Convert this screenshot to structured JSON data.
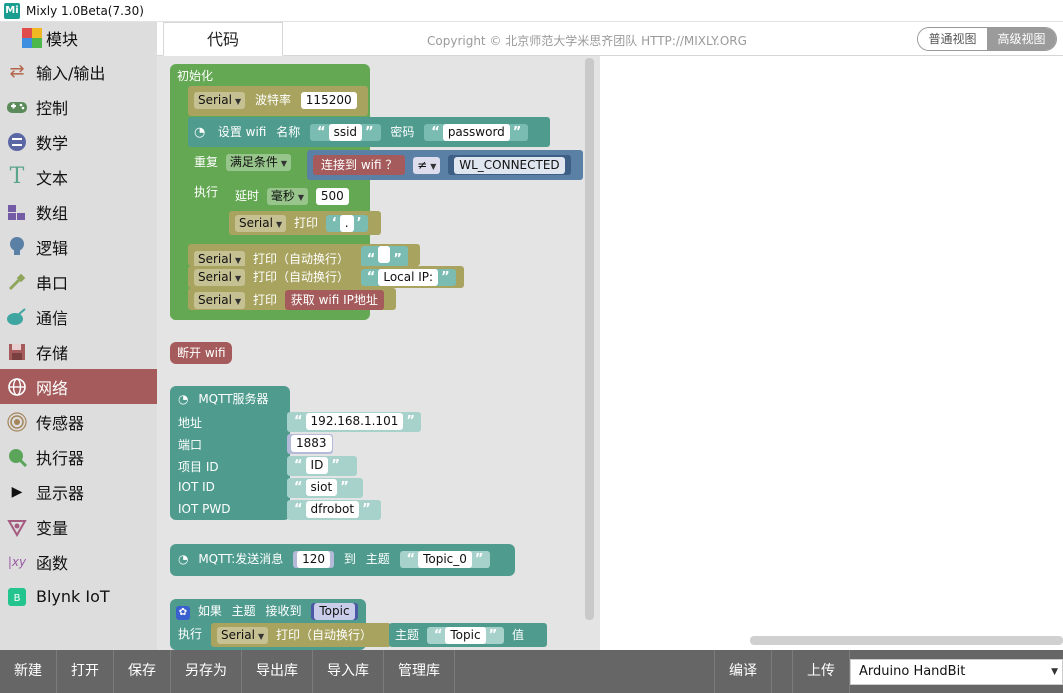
{
  "window": {
    "title": "Mixly 1.0Beta(7.30)",
    "app_icon": "Mi"
  },
  "sidebar": {
    "header": "模块",
    "items": [
      {
        "label": "输入/输出",
        "icon": "io-arrows-icon",
        "color": "#b5654a"
      },
      {
        "label": "控制",
        "icon": "gamepad-icon",
        "color": "#5b8a5b"
      },
      {
        "label": "数学",
        "icon": "math-icon",
        "color": "#5b67a5"
      },
      {
        "label": "文本",
        "icon": "text-t-icon",
        "color": "#5ba58c"
      },
      {
        "label": "数组",
        "icon": "array-blocks-icon",
        "color": "#745ba5"
      },
      {
        "label": "逻辑",
        "icon": "bulb-icon",
        "color": "#5b80a5"
      },
      {
        "label": "串口",
        "icon": "plug-icon",
        "color": "#8fa55b"
      },
      {
        "label": "通信",
        "icon": "satellite-icon",
        "color": "#3fa5a0"
      },
      {
        "label": "存储",
        "icon": "floppy-icon",
        "color": "#a55b5b"
      },
      {
        "label": "网络",
        "icon": "globe-icon",
        "color": "#ffffff",
        "active": true
      },
      {
        "label": "传感器",
        "icon": "sensor-icon",
        "color": "#a5855b"
      },
      {
        "label": "执行器",
        "icon": "actuator-icon",
        "color": "#5ba55b"
      },
      {
        "label": "显示器",
        "icon": "play-triangle-icon",
        "color": "#111111"
      },
      {
        "label": "变量",
        "icon": "variable-icon",
        "color": "#a55b80"
      },
      {
        "label": "函数",
        "icon": "function-icon",
        "color": "#9a5ba5"
      },
      {
        "label": "Blynk IoT",
        "icon": "blynk-icon",
        "color": "#23c48e"
      }
    ]
  },
  "tabbar": {
    "code_tab": "代码",
    "copyright": "Copyright © 北京师范大学米思齐团队 HTTP://MIXLY.ORG",
    "view_normal": "普通视图",
    "view_advanced": "高级视图"
  },
  "blocks": {
    "setup": {
      "label": "初始化",
      "serial": "Serial",
      "baud_label": "波特率",
      "baud": "115200",
      "wifi_label": "设置 wifi",
      "name_label": "名称",
      "ssid": "ssid",
      "pwd_label": "密码",
      "password": "password",
      "repeat_label": "重复",
      "repeat_mode": "满足条件",
      "connected_label": "连接到 wifi ？",
      "neq": "≠",
      "wl_connected": "WL_CONNECTED",
      "do_label": "执行",
      "delay_label": "延时",
      "delay_unit": "毫秒",
      "delay_ms": "500",
      "print_label": "打印",
      "dot": ".",
      "println_label": "打印（自动换行）",
      "local_ip": "Local IP:",
      "get_ip_label": "获取 wifi IP地址"
    },
    "disconnect": {
      "label": "断开 wifi"
    },
    "mqtt_server": {
      "title": "MQTT服务器",
      "address_label": "地址",
      "address": "192.168.1.101",
      "port_label": "端口",
      "port": "1883",
      "project_label": "项目 ID",
      "project_id": "ID",
      "iot_id_label": "IOT ID",
      "iot_id": "siot",
      "iot_pwd_label": "IOT PWD",
      "iot_pwd": "dfrobot"
    },
    "mqtt_send": {
      "label": "MQTT:发送消息",
      "value": "120",
      "to_label": "到",
      "topic_label": "主题",
      "topic": "Topic_0"
    },
    "mqtt_receive": {
      "if_label": "如果",
      "topic_label": "主题",
      "received_label": "接收到",
      "topic_var": "Topic",
      "do_label": "执行",
      "serial": "Serial",
      "println_label": "打印（自动换行）",
      "topic_text_label": "主题",
      "topic_text": "Topic",
      "value_label": "值"
    }
  },
  "bottombar": {
    "buttons": [
      "新建",
      "打开",
      "保存",
      "另存为",
      "导出库",
      "导入库",
      "管理库"
    ],
    "compile": "编译",
    "upload": "上传",
    "board": "Arduino HandBit"
  }
}
